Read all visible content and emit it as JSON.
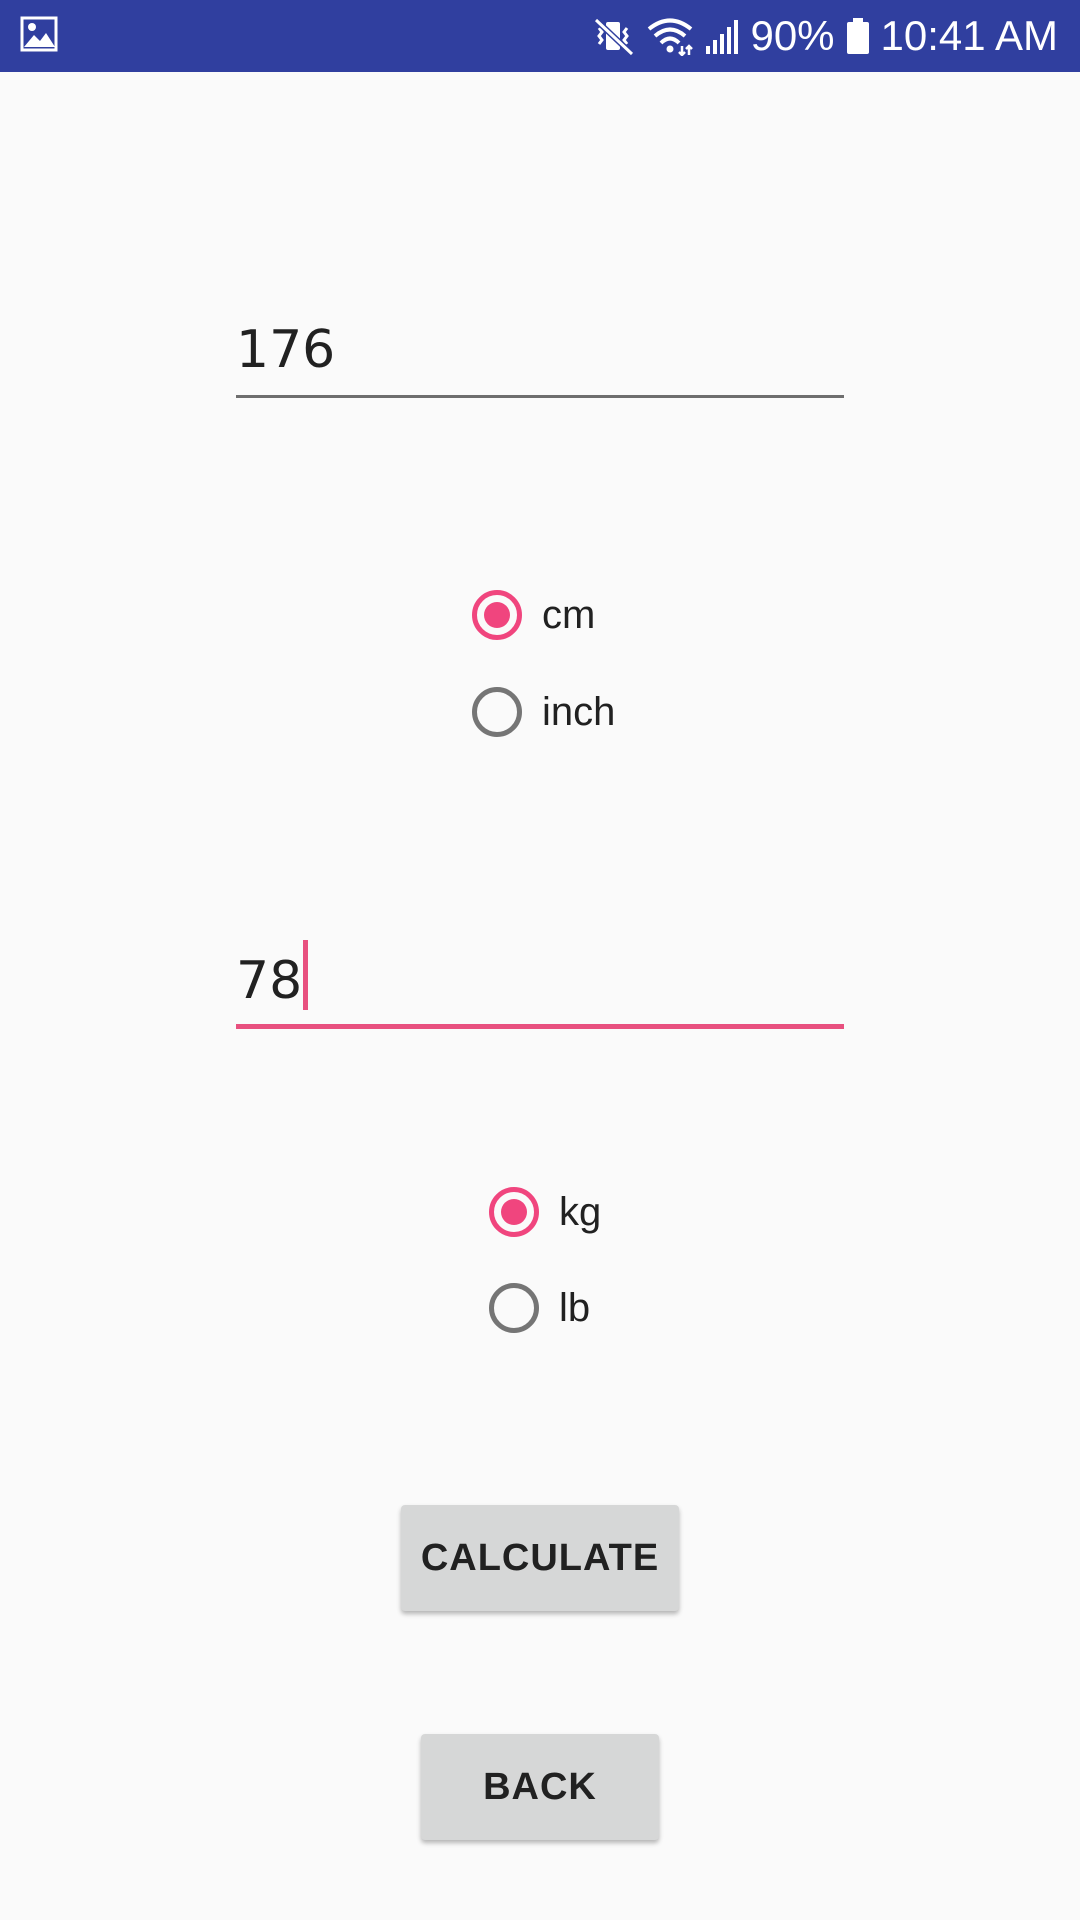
{
  "status_bar": {
    "battery": "90%",
    "time": "10:41 AM",
    "icons": [
      "gallery-icon",
      "vibrate-mute-icon",
      "wifi-icon",
      "signal-icon",
      "battery-icon"
    ]
  },
  "height": {
    "value": "176",
    "units": [
      {
        "label": "cm",
        "checked": true
      },
      {
        "label": "inch",
        "checked": false
      }
    ]
  },
  "weight": {
    "value": "78",
    "units": [
      {
        "label": "kg",
        "checked": true
      },
      {
        "label": "lb",
        "checked": false
      }
    ]
  },
  "buttons": {
    "calculate": "CALCULATE",
    "back": "BACK"
  },
  "colors": {
    "status_bar": "#303f9f",
    "accent": "#f0457e",
    "background": "#fafafa",
    "button": "#d6d7d7"
  }
}
